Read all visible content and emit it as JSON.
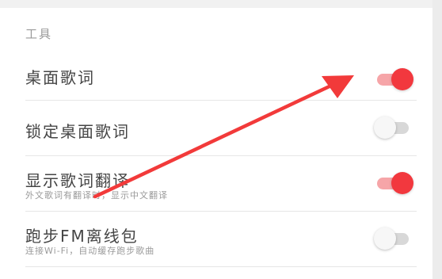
{
  "section": {
    "header": "工具"
  },
  "settings": [
    {
      "title": "桌面歌词",
      "subtitle": "",
      "enabled": true
    },
    {
      "title": "锁定桌面歌词",
      "subtitle": "",
      "enabled": false
    },
    {
      "title": "显示歌词翻译",
      "subtitle": "外文歌词有翻译时，显示中文翻译",
      "enabled": true
    },
    {
      "title": "跑步FM离线包",
      "subtitle": "连接Wi-Fi，自动缓存跑步歌曲",
      "enabled": false
    }
  ],
  "colors": {
    "accent": "#f2383e",
    "accent_track": "#f6a5a8",
    "arrow": "#f23a3a"
  }
}
